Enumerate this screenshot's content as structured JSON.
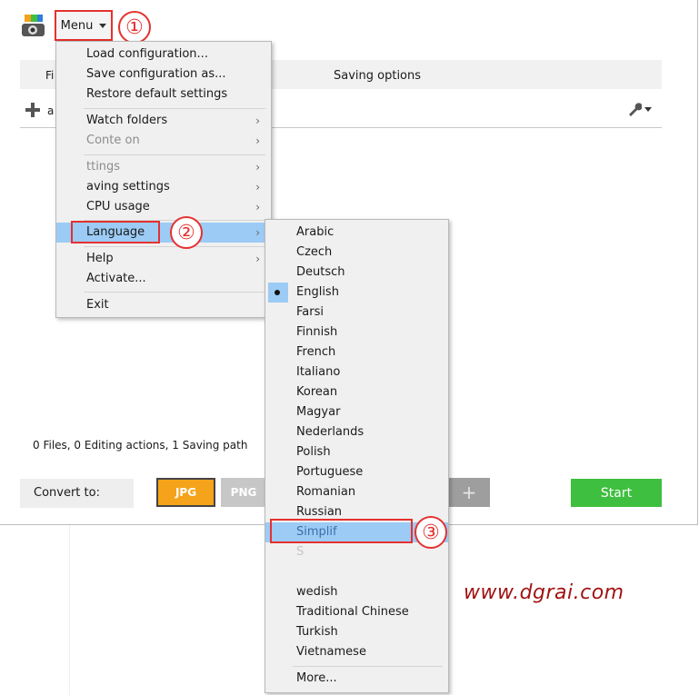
{
  "toolbar": {
    "menu_label": "Menu"
  },
  "badges": [
    "①",
    "②",
    "③"
  ],
  "tabs": {
    "files_label": "Fi",
    "saving_label": "Saving options"
  },
  "actions": {
    "add_label": "a"
  },
  "status": {
    "text": "0 Files,  0 Editing actions,  1 Saving path"
  },
  "convert": {
    "label": "Convert to:",
    "formats": {
      "jpg": "JPG",
      "png": "PNG"
    },
    "add_symbol": "+",
    "start_label": "Start"
  },
  "menu": {
    "items": [
      {
        "label": "Load configuration..."
      },
      {
        "label": "Save configuration as..."
      },
      {
        "label": "Restore default settings"
      },
      {
        "label": "Watch folders"
      },
      {
        "label": "Conte              on"
      },
      {
        "label": "         ttings"
      },
      {
        "label": "aving settings"
      },
      {
        "label": "CPU usage"
      },
      {
        "label": "Language"
      },
      {
        "label": "Help"
      },
      {
        "label": "Activate..."
      },
      {
        "label": "Exit"
      }
    ]
  },
  "languages": {
    "selected": "English",
    "items": [
      "Arabic",
      "Czech",
      "Deutsch",
      "English",
      "Farsi",
      "Finnish",
      "French",
      "Italiano",
      "Korean",
      "Magyar",
      "Nederlands",
      "Polish",
      "Portuguese",
      "Romanian",
      "Russian",
      "Simplif",
      "S",
      "",
      "",
      "wedish",
      "Traditional Chinese",
      "Turkish",
      "Vietnamese"
    ],
    "more_label": "More..."
  },
  "watermark": "www.dgrai.com",
  "colors": {
    "annotation_red": "#e5312f",
    "menu_highlight": "#9ccbf5",
    "jpg_orange": "#f5a31a",
    "start_green": "#3fbf3f",
    "watermark": "#a01313"
  }
}
